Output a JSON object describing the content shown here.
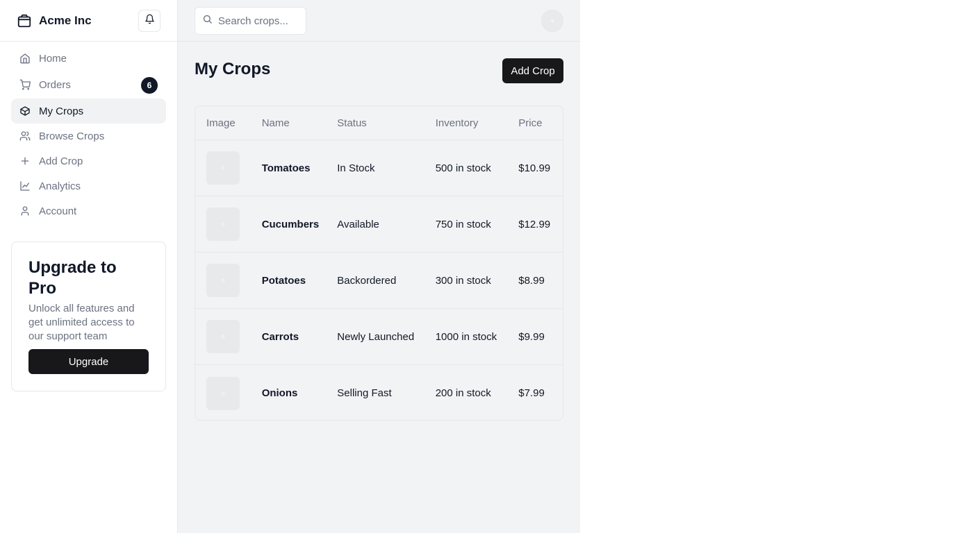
{
  "brand": {
    "name": "Acme Inc",
    "icon": "package-icon"
  },
  "sidebar": {
    "items": [
      {
        "label": "Home",
        "icon": "home-icon",
        "active": false
      },
      {
        "label": "Orders",
        "icon": "cart-icon",
        "active": false,
        "badge": "6"
      },
      {
        "label": "My Crops",
        "icon": "box-icon",
        "active": true
      },
      {
        "label": "Browse Crops",
        "icon": "users-icon",
        "active": false
      },
      {
        "label": "Add Crop",
        "icon": "plus-icon",
        "active": false
      },
      {
        "label": "Analytics",
        "icon": "chart-line-icon",
        "active": false
      },
      {
        "label": "Account",
        "icon": "user-icon",
        "active": false
      }
    ]
  },
  "upgrade": {
    "title": "Upgrade to Pro",
    "text": "Unlock all features and get unlimited access to our support team",
    "button": "Upgrade"
  },
  "search": {
    "placeholder": "Search crops..."
  },
  "main": {
    "title": "My Crops",
    "add_button": "Add Crop"
  },
  "table": {
    "headers": [
      "Image",
      "Name",
      "Status",
      "Inventory",
      "Price"
    ],
    "rows": [
      {
        "name": "Tomatoes",
        "status": "In Stock",
        "inventory": "500 in stock",
        "price": "$10.99"
      },
      {
        "name": "Cucumbers",
        "status": "Available",
        "inventory": "750 in stock",
        "price": "$12.99"
      },
      {
        "name": "Potatoes",
        "status": "Backordered",
        "inventory": "300 in stock",
        "price": "$8.99"
      },
      {
        "name": "Carrots",
        "status": "Newly Launched",
        "inventory": "1000 in stock",
        "price": "$9.99"
      },
      {
        "name": "Onions",
        "status": "Selling Fast",
        "inventory": "200 in stock",
        "price": "$7.99"
      }
    ]
  },
  "colors": {
    "primary": "#18181b",
    "muted_text": "#6b7280",
    "border": "#e5e7eb",
    "main_bg": "#f2f3f5"
  }
}
